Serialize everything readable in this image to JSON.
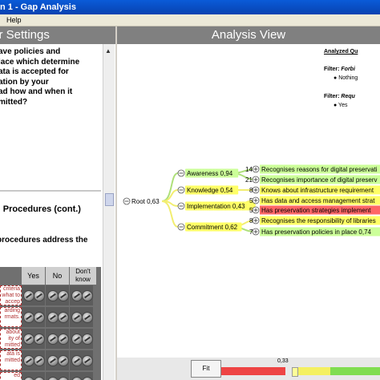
{
  "window": {
    "title": "n 1 - Gap Analysis"
  },
  "menu": {
    "help": "Help"
  },
  "left": {
    "header": "ter Settings",
    "question1": [
      "ave policies and",
      "lace which determine",
      "ata is accepted for",
      "ation by your",
      "ad how and when it",
      "mitted?"
    ],
    "section_title": "d Procedures (cont.)",
    "question2": [
      "procedures address the"
    ],
    "table": {
      "headers": [
        "Yes",
        "No",
        "Don't know"
      ],
      "row_labels": [
        "criteria\nwhat to\naccep",
        "arding\nrmats.",
        "about\nity of\nmitted",
        "ata is\nmitted",
        "ed"
      ]
    }
  },
  "right": {
    "header": "Analysis View",
    "info": {
      "analyzed_label": "Analyzed Qu",
      "filter1_label": "Filter:",
      "filter1_value": "Forbi",
      "filter1_bullet": "Nothing",
      "filter2_label": "Filter:",
      "filter2_value": "Requ",
      "filter2_bullet": "Yes"
    },
    "tree": {
      "root": "Root 0,63",
      "categories": [
        {
          "label": "Awareness 0,94",
          "color": "#ccff99"
        },
        {
          "label": "Knowledge 0,54",
          "color": "#ffff66"
        },
        {
          "label": "Implementation 0,43",
          "color": "#ffff66"
        },
        {
          "label": "Commitment 0,62",
          "color": "#ffff66"
        }
      ],
      "leaves": [
        {
          "count": "14",
          "label": "Recognises reasons for digital preservati",
          "color": "#ccff99"
        },
        {
          "count": "21",
          "label": "Recognises importance of digital preserv",
          "color": "#ccff99"
        },
        {
          "count": "8",
          "label": "Knows about infrastructure requirement",
          "color": "#ffff66"
        },
        {
          "count": "5",
          "label": "Has data and access management strat",
          "color": "#ffff66"
        },
        {
          "count": "5",
          "label": "Has preservation strategies implement",
          "color": "#ff6666"
        },
        {
          "count": "8",
          "label": "Recognises the responsibility of libraries",
          "color": "#ffff66"
        },
        {
          "count": "7",
          "label": "Has preservation policies in place 0,74",
          "color": "#ccff99"
        }
      ]
    },
    "bottom": {
      "fit_label": "Fit",
      "gauge_value": "0,33",
      "gauge_fraction": 0.33
    }
  }
}
